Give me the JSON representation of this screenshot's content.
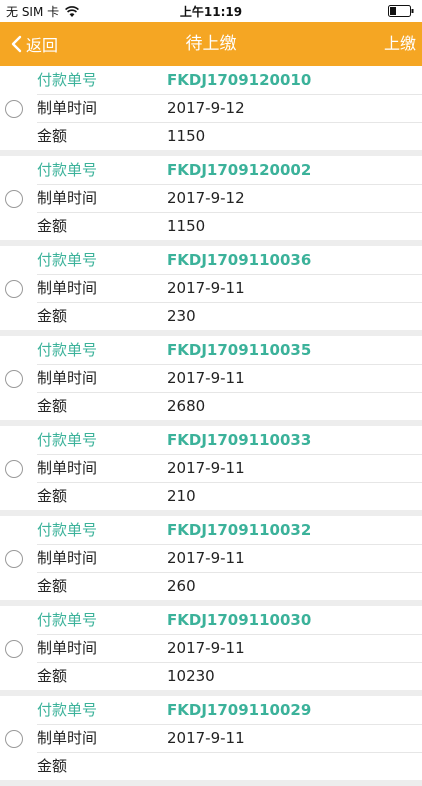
{
  "status_bar": {
    "carrier": "无 SIM 卡",
    "time": "上午11:19"
  },
  "nav": {
    "back_label": "返回",
    "title": "待上缴",
    "action_label": "上缴",
    "color": "#f5a623"
  },
  "fields": {
    "order_no": "付款单号",
    "created": "制单时间",
    "amount": "金额"
  },
  "records": [
    {
      "order_no": "FKDJ1709120010",
      "created": "2017-9-12",
      "amount": "1150",
      "selected": false
    },
    {
      "order_no": "FKDJ1709120002",
      "created": "2017-9-12",
      "amount": "1150",
      "selected": false
    },
    {
      "order_no": "FKDJ1709110036",
      "created": "2017-9-11",
      "amount": "230",
      "selected": false
    },
    {
      "order_no": "FKDJ1709110035",
      "created": "2017-9-11",
      "amount": "2680",
      "selected": false
    },
    {
      "order_no": "FKDJ1709110033",
      "created": "2017-9-11",
      "amount": "210",
      "selected": false
    },
    {
      "order_no": "FKDJ1709110032",
      "created": "2017-9-11",
      "amount": "260",
      "selected": false
    },
    {
      "order_no": "FKDJ1709110030",
      "created": "2017-9-11",
      "amount": "10230",
      "selected": false
    },
    {
      "order_no": "FKDJ1709110029",
      "created": "2017-9-11",
      "amount": "",
      "selected": false
    }
  ]
}
